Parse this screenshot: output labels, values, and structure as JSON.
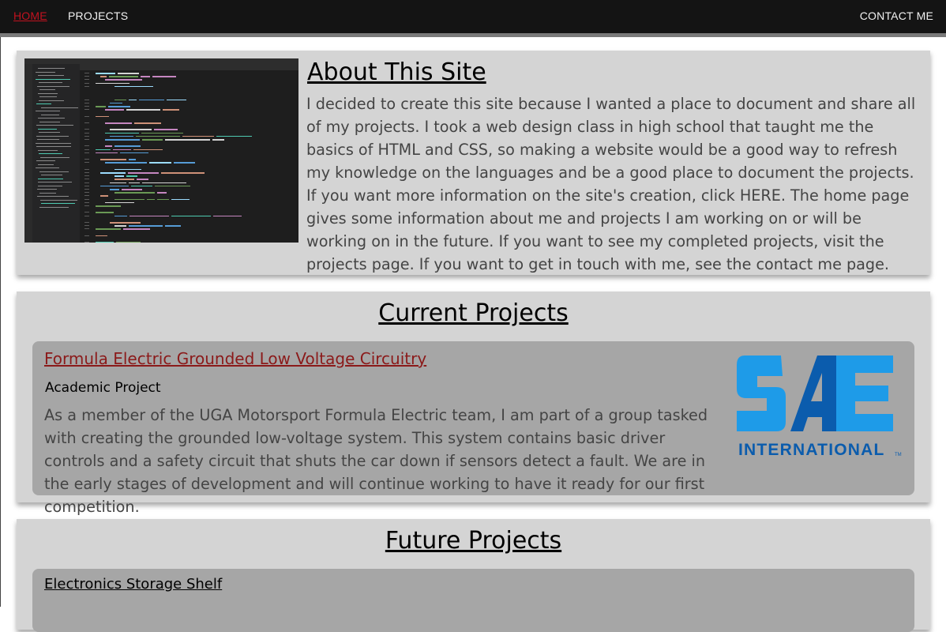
{
  "nav": {
    "home": "HOME",
    "projects": "PROJECTS",
    "contact": "CONTACT ME"
  },
  "about": {
    "title": "About This Site",
    "text": "I decided to create this site because I wanted a place to document and share all of my projects. I took a web design class in high school that taught me the basics of HTML and CSS, so making a website would be a good way to refresh my knowledge on the languages and be a good place to document the projects. If you want more information on the site's creation, click HERE. The home page gives some information about me and projects I am working on or will be working on in the future. If you want to see my completed projects, visit the projects page. If you want to get in touch with me, see the contact me page."
  },
  "current": {
    "title": "Current Projects",
    "project": {
      "name": "Formula Electric Grounded Low Voltage Circuitry",
      "type": "Academic Project",
      "description": "As a member of the UGA Motorsport Formula Electric team, I am part of a group tasked with creating the grounded low-voltage system. This system contains basic driver controls and a safety circuit that shuts the car down if sensors detect a fault. We are in the early stages of development and will continue working to have it ready for our first competition.",
      "logo_text": "INTERNATIONAL",
      "logo_tm": "TM",
      "logo_colors": {
        "light": "#1e9be8",
        "dark": "#0b5cad"
      }
    }
  },
  "future": {
    "title": "Future Projects",
    "project": {
      "name": "Electronics Storage Shelf",
      "description": ""
    }
  },
  "colors": {
    "navbar": "#141414",
    "active_link": "#c1121f",
    "panel": "#d4d4d4",
    "card": "#a6a6a6",
    "project_link": "#8b1a1a"
  }
}
